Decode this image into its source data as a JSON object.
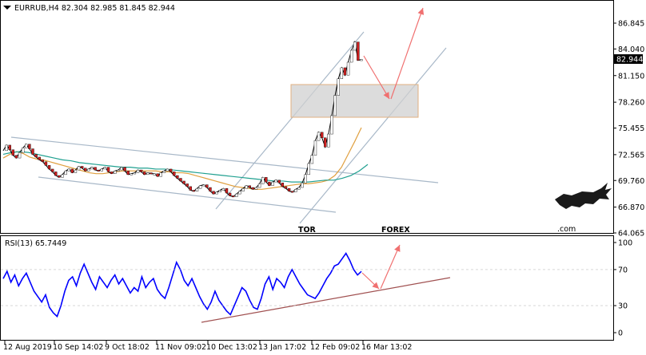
{
  "chart_data": {
    "type": "line",
    "header": "EURRUB,H4  82.304 82.985 81.845 82.944",
    "price_panel": {
      "y_ticks": [
        "86.845",
        "84.040",
        "81.150",
        "78.260",
        "75.455",
        "72.565",
        "69.760",
        "66.870",
        "64.065"
      ],
      "current_price_label": "82.944",
      "ylim": [
        64.065,
        86.845
      ]
    },
    "rsi_panel": {
      "label": "RSI(13) 65.7449",
      "y_ticks": [
        "100",
        "70",
        "30",
        "0"
      ],
      "ylim": [
        0,
        100
      ]
    },
    "x_tick_labels": [
      "12 Aug 2019",
      "10 Sep 14:02",
      "9 Oct 18:02",
      "11 Nov 09:02",
      "10 Dec 13:02",
      "13 Jan 17:02",
      "12 Feb 09:02",
      "16 Mar 13:02"
    ],
    "price_close": [
      73.0,
      73.6,
      73.1,
      72.5,
      72.2,
      72.8,
      73.3,
      73.7,
      73.2,
      72.6,
      72.3,
      72.0,
      71.8,
      71.4,
      71.0,
      70.7,
      70.3,
      70.1,
      70.4,
      70.8,
      71.0,
      70.6,
      70.9,
      71.3,
      71.1,
      70.8,
      71.0,
      71.2,
      70.9,
      70.8,
      71.0,
      71.2,
      70.7,
      70.5,
      70.8,
      70.9,
      71.2,
      70.8,
      70.4,
      70.5,
      70.6,
      70.9,
      70.7,
      70.4,
      70.6,
      70.5,
      70.5,
      70.2,
      70.6,
      70.8,
      71.0,
      70.7,
      70.3,
      70.0,
      69.7,
      69.4,
      69.1,
      68.7,
      68.6,
      68.9,
      69.2,
      69.3,
      69.0,
      68.6,
      68.3,
      68.5,
      68.7,
      68.9,
      68.4,
      68.1,
      68.0,
      68.3,
      68.6,
      68.9,
      69.2,
      69.0,
      68.8,
      69.0,
      69.4,
      70.1,
      69.6,
      69.2,
      69.6,
      69.8,
      69.5,
      69.1,
      68.9,
      68.6,
      68.5,
      68.8,
      69.0,
      69.5,
      70.4,
      71.6,
      72.5,
      74.1,
      75.0,
      74.4,
      73.4,
      74.8,
      76.8,
      79.0,
      80.8,
      82.0,
      81.2,
      82.6,
      83.9,
      84.8,
      82.8,
      82.9
    ],
    "ma_fast": [
      72.2,
      72.6,
      72.9,
      72.7,
      72.3,
      72.1,
      72.0,
      71.8,
      71.6,
      71.4,
      71.2,
      71.0,
      70.8,
      70.6,
      70.5,
      70.5,
      70.6,
      70.7,
      70.8,
      70.8,
      70.8,
      70.8,
      70.8,
      70.8,
      70.7,
      70.7,
      70.6,
      70.6,
      70.5,
      70.3,
      70.1,
      69.9,
      69.7,
      69.5,
      69.3,
      69.1,
      69.0,
      68.9,
      68.8,
      68.8,
      68.9,
      69.0,
      69.1,
      69.2,
      69.3,
      69.4,
      69.4,
      69.5,
      69.6,
      69.8,
      70.3,
      71.2,
      72.6,
      74.0,
      75.5
    ],
    "ma_slow": [
      72.6,
      72.8,
      72.9,
      72.8,
      72.6,
      72.4,
      72.2,
      72.0,
      71.9,
      71.7,
      71.6,
      71.5,
      71.4,
      71.3,
      71.2,
      71.2,
      71.1,
      71.1,
      71.0,
      71.0,
      70.9,
      70.8,
      70.7,
      70.6,
      70.5,
      70.4,
      70.3,
      70.2,
      70.1,
      70.0,
      69.9,
      69.8,
      69.7,
      69.7,
      69.6,
      69.6,
      69.6,
      69.7,
      69.8,
      69.8,
      70.0,
      70.3,
      70.8,
      71.5
    ],
    "rsi": [
      60,
      68,
      56,
      64,
      52,
      60,
      66,
      56,
      46,
      40,
      34,
      42,
      28,
      22,
      18,
      30,
      46,
      58,
      62,
      52,
      66,
      76,
      66,
      56,
      48,
      62,
      56,
      50,
      58,
      64,
      54,
      60,
      52,
      44,
      50,
      46,
      62,
      50,
      56,
      60,
      48,
      42,
      38,
      50,
      64,
      78,
      70,
      58,
      52,
      60,
      50,
      40,
      32,
      26,
      34,
      46,
      36,
      30,
      24,
      20,
      30,
      40,
      50,
      46,
      36,
      28,
      26,
      38,
      54,
      62,
      48,
      60,
      56,
      50,
      62,
      70,
      62,
      54,
      48,
      42,
      40,
      38,
      44,
      52,
      60,
      66,
      74,
      76,
      82,
      88,
      80,
      70,
      64,
      68
    ]
  },
  "watermark": {
    "part1": "TOR",
    "part2": "FOREX",
    "part3": ".com"
  },
  "colors": {
    "price_line": "#000000",
    "ma_fast": "#e0a040",
    "ma_slow": "#20a090",
    "rsi_line": "#0000ff",
    "channel": "#a8b8c8",
    "arrow": "#f07070",
    "zone_fill": "#d0d0d0",
    "zone_border": "#e0b080",
    "watermark_dark": "#1a1a1a",
    "watermark_red": "#e8380e"
  }
}
